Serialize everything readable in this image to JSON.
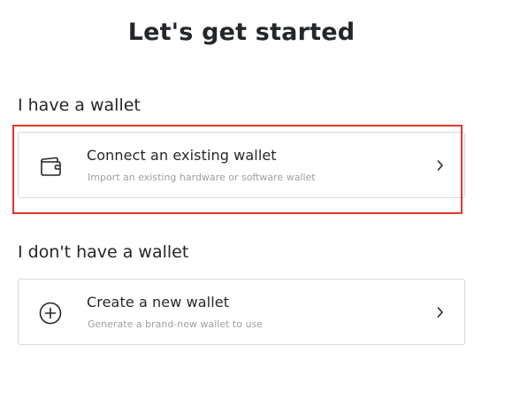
{
  "title": "Let's get started",
  "sections": [
    {
      "heading": "I have a wallet",
      "option": {
        "title": "Connect an existing wallet",
        "subtitle": "Import an existing hardware or software wallet",
        "icon": "wallet-icon"
      }
    },
    {
      "heading": "I don't have a wallet",
      "option": {
        "title": "Create a new wallet",
        "subtitle": "Generate a brand-new wallet to use",
        "icon": "plus-circle-icon"
      }
    }
  ],
  "colors": {
    "highlight": "#e0382b",
    "border": "#d6d9dc",
    "subtitle": "#9b9fa4",
    "text": "#24272a"
  }
}
